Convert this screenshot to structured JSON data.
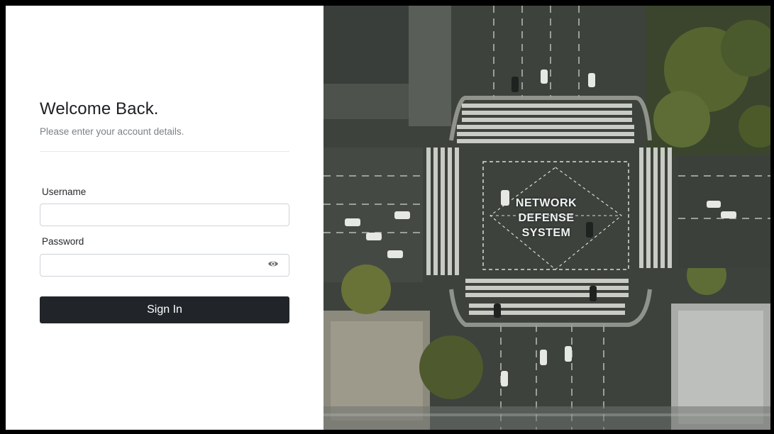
{
  "login": {
    "title": "Welcome Back.",
    "subtitle": "Please enter your account details.",
    "username_label": "Username",
    "username_value": "",
    "password_label": "Password",
    "password_value": "",
    "signin_label": "Sign In"
  },
  "hero": {
    "line1": "NETWORK",
    "line2": "DEFENSE",
    "line3": "SYSTEM"
  },
  "colors": {
    "button_bg": "#212529",
    "page_bg": "#ffffff",
    "frame": "#000000"
  }
}
